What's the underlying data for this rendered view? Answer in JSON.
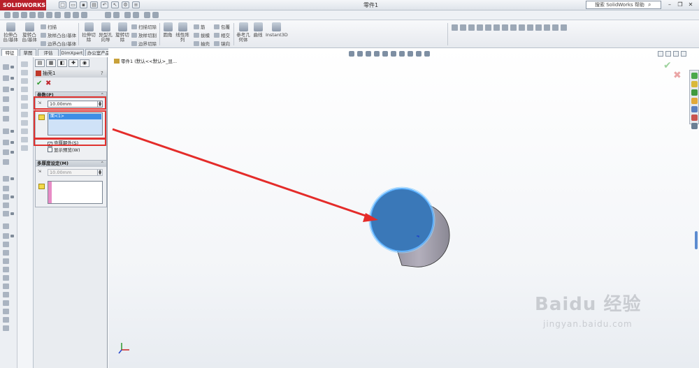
{
  "app": {
    "brand": "SOLIDWORKS",
    "document_title": "零件1",
    "search_placeholder": "搜索 SolidWorks 帮助"
  },
  "ribbon": {
    "extrude_boss": "拉伸凸\n台/基体",
    "revolve_boss": "旋转凸\n台/基体",
    "sweep": "扫描",
    "loft_boss": "放样凸台/基体",
    "boundary_boss": "边界凸台/基体",
    "extrude_cut": "拉伸切\n除",
    "hole_wizard": "异型孔\n向导",
    "revolve_cut": "旋转切\n除",
    "swept_cut": "扫描切除",
    "lofted_cut": "放样切割",
    "boundary_cut": "边界切除",
    "fillet": "圆角",
    "linear_pattern": "线性阵\n列",
    "rib": "筋",
    "draft": "拔模",
    "shell": "抽壳",
    "wrap": "包覆",
    "intersect": "相交",
    "mirror": "镜向",
    "ref_geometry": "参考几\n何体",
    "curves": "曲线",
    "instant3d": "Instant3D"
  },
  "tabs": [
    "特征",
    "草图",
    "评估",
    "DimXpert",
    "办公室产品"
  ],
  "property_manager": {
    "title": "抽壳1",
    "help": "?",
    "params_group": {
      "title": "参数(P)",
      "thickness": "10.00mm",
      "face_item": "面<1>",
      "shell_outward": "壳厚朝外(S)",
      "shell_outward_checked": true,
      "show_preview": "显示预览(W)",
      "show_preview_checked": false
    },
    "multi_group": {
      "title": "多厚度设定(M)",
      "thickness": "10.00mm"
    }
  },
  "viewport": {
    "tree_text": "零件1 (默认<<默认>_显..."
  },
  "watermark": {
    "main": "Baidu 经验",
    "sub": "jingyan.baidu.com"
  }
}
